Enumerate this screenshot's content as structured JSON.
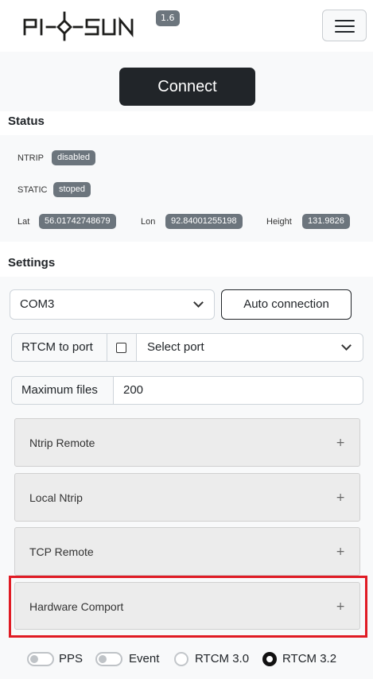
{
  "header": {
    "logo_text": "PI-SUN",
    "version": "1.6"
  },
  "connect_label": "Connect",
  "status": {
    "title": "Status",
    "ntrip_label": "NTRIP",
    "ntrip_value": "disabled",
    "static_label": "STATIC",
    "static_value": "stoped",
    "lat_label": "Lat",
    "lat_value": "56.01742748679",
    "lon_label": "Lon",
    "lon_value": "92.84001255198",
    "height_label": "Height",
    "height_value": "131.9826"
  },
  "settings": {
    "title": "Settings",
    "com_port": "COM3",
    "auto_connection": "Auto connection",
    "rtcm_to_port": "RTCM to port",
    "rtcm_checked": false,
    "select_port": "Select port",
    "max_files_label": "Maximum files",
    "max_files_value": "200"
  },
  "accordion": [
    {
      "label": "Ntrip Remote",
      "icon": "+"
    },
    {
      "label": "Local Ntrip",
      "icon": "+"
    },
    {
      "label": "TCP Remote",
      "icon": "+"
    },
    {
      "label": "Hardware Comport",
      "icon": "+"
    }
  ],
  "bottom": {
    "pps": "PPS",
    "event": "Event",
    "rtcm30": "RTCM 3.0",
    "rtcm32": "RTCM 3.2",
    "selected_rtcm": "RTCM 3.2"
  },
  "colors": {
    "highlight": "#e01b24",
    "badge": "#6c757d",
    "dark": "#212529"
  }
}
